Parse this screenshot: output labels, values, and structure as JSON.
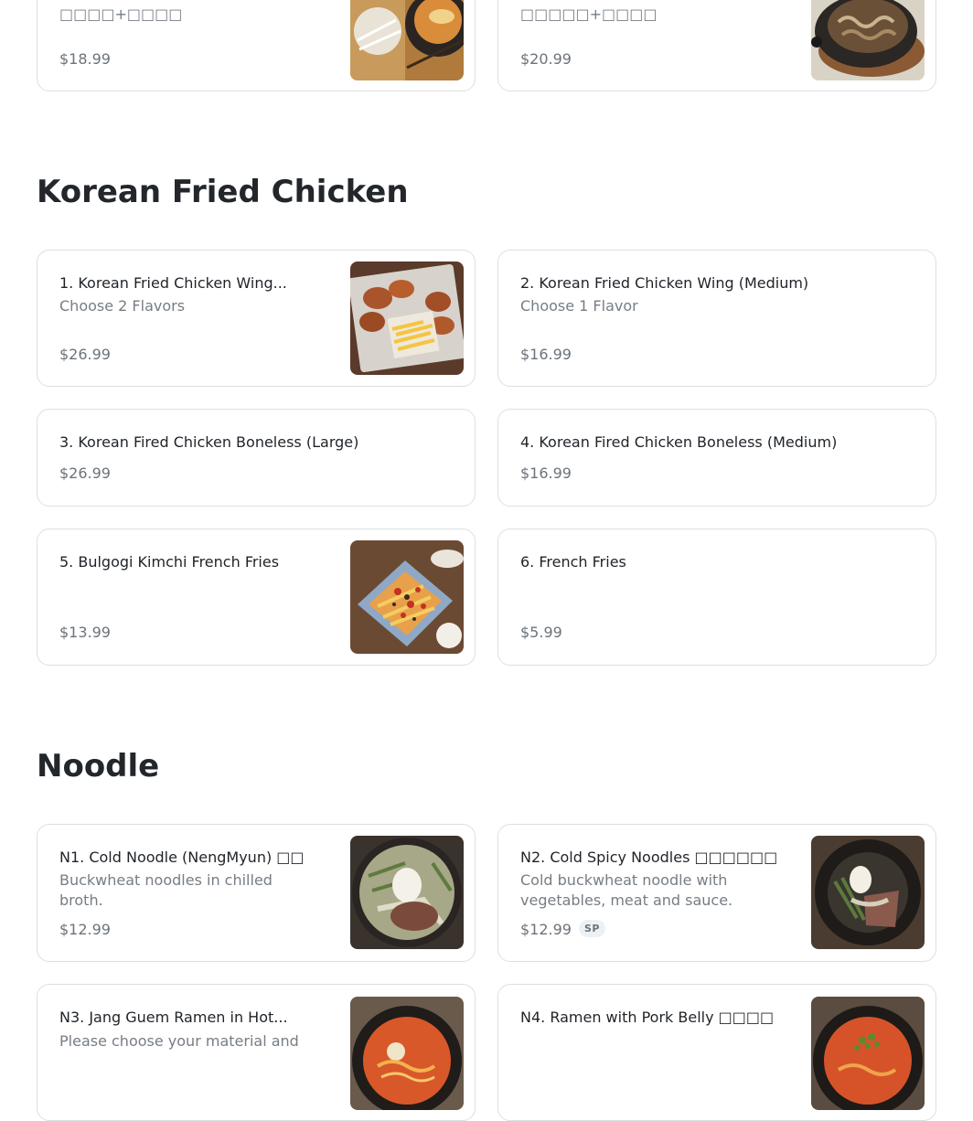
{
  "top_row": [
    {
      "subtitle": "□□□□+□□□□",
      "price": "$18.99",
      "image_icon": "tofu-stew-photo"
    },
    {
      "subtitle": "□□□□□+□□□□",
      "price": "$20.99",
      "image_icon": "beef-skillet-photo"
    }
  ],
  "sections": [
    {
      "title": "Korean Fried Chicken",
      "items": [
        {
          "name": "1. Korean Fried Chicken Wing...",
          "description": "Choose 2 Flavors",
          "price": "$26.99",
          "has_image": true
        },
        {
          "name": "2. Korean Fried Chicken Wing (Medium)",
          "description": "Choose 1 Flavor",
          "price": "$16.99",
          "has_image": false
        },
        {
          "name": "3. Korean Fired Chicken Boneless (Large)",
          "price": "$26.99",
          "has_image": false
        },
        {
          "name": "4. Korean Fired Chicken Boneless (Medium)",
          "price": "$16.99",
          "has_image": false
        },
        {
          "name": "5. Bulgogi Kimchi French Fries",
          "price": "$13.99",
          "has_image": true
        },
        {
          "name": "6. French Fries",
          "price": "$5.99",
          "has_image": false
        }
      ]
    },
    {
      "title": "Noodle",
      "items": [
        {
          "name": "N1. Cold Noodle (NengMyun) □□",
          "description_lines": [
            "Buckwheat noodles in chilled",
            "broth."
          ],
          "price": "$12.99",
          "has_image": true
        },
        {
          "name": "N2. Cold Spicy Noodles □□□□□□",
          "description_lines": [
            "Cold buckwheat noodle with",
            "vegetables, meat and sauce."
          ],
          "price": "$12.99",
          "badge": "SP",
          "has_image": true
        },
        {
          "name": "N3. Jang Guem Ramen in Hot...",
          "description_lines": [
            "Please choose your material and"
          ],
          "has_image": true
        },
        {
          "name": "N4. Ramen with Pork Belly □□□□",
          "has_image": true
        }
      ]
    }
  ],
  "colors": {
    "border": "#dcdfe3",
    "muted_text": "#767d85",
    "price_text": "#6c737a",
    "heading": "#23272b"
  }
}
